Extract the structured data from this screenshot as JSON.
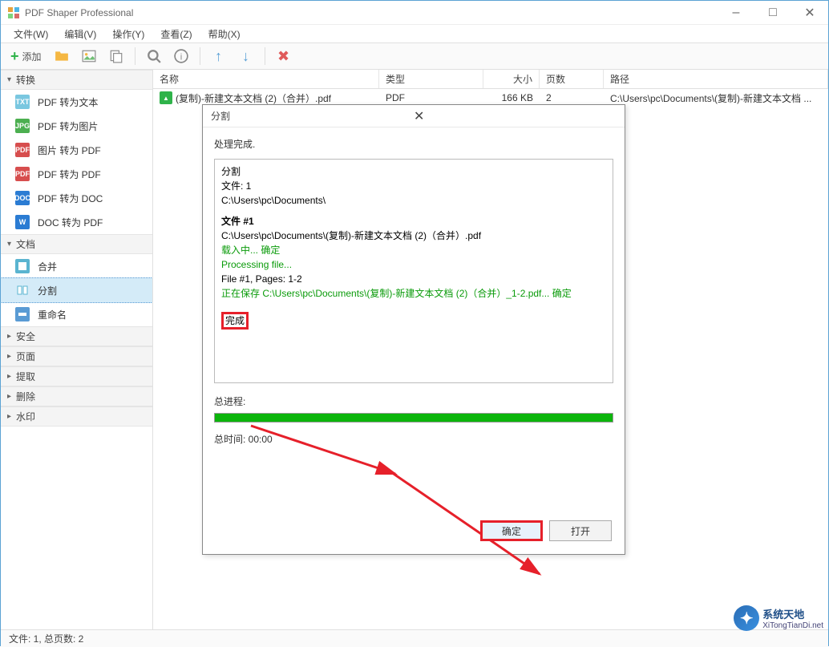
{
  "app": {
    "title": "PDF Shaper Professional"
  },
  "menu": {
    "file": "文件(W)",
    "edit": "编辑(V)",
    "action": "操作(Y)",
    "view": "查看(Z)",
    "help": "帮助(X)"
  },
  "toolbar": {
    "add": "添加"
  },
  "sidebar": {
    "cat_convert": "转换",
    "cat_docs": "文档",
    "cat_security": "安全",
    "cat_pages": "页面",
    "cat_extract": "提取",
    "cat_delete": "删除",
    "cat_watermark": "水印",
    "items": {
      "pdf2txt": "PDF 转为文本",
      "pdf2img": "PDF 转为图片",
      "img2pdf": "图片 转为 PDF",
      "pdf2pdf": "PDF 转为 PDF",
      "pdf2doc": "PDF 转为 DOC",
      "doc2pdf": "DOC 转为 PDF",
      "merge": "合并",
      "split": "分割",
      "rename": "重命名"
    }
  },
  "columns": {
    "name": "名称",
    "type": "类型",
    "size": "大小",
    "pages": "页数",
    "path": "路径"
  },
  "files": [
    {
      "name": "(复制)-新建文本文档 (2)（合并）.pdf",
      "type": "PDF",
      "size": "166 KB",
      "pages": "2",
      "path": "C:\\Users\\pc\\Documents\\(复制)-新建文本文档 ..."
    }
  ],
  "dialog": {
    "title": "分割",
    "status": "处理完成.",
    "log": {
      "l1": "分割",
      "l2": "文件: 1",
      "l3": "C:\\Users\\pc\\Documents\\",
      "l4": "文件 #1",
      "l5": "C:\\Users\\pc\\Documents\\(复制)-新建文本文档 (2)（合并）.pdf",
      "l6": "载入中... 确定",
      "l7": "Processing file...",
      "l8": "File #1, Pages: 1-2",
      "l9": "正在保存 C:\\Users\\pc\\Documents\\(复制)-新建文本文档 (2)（合并）_1-2.pdf... 确定",
      "done": "完成"
    },
    "total_progress": "总进程:",
    "total_time": "总时间: 00:00",
    "ok": "确定",
    "open": "打开"
  },
  "status": "文件: 1, 总页数: 2",
  "watermark": {
    "main": "系统天地",
    "sub": "XiTongTianDi.net"
  }
}
